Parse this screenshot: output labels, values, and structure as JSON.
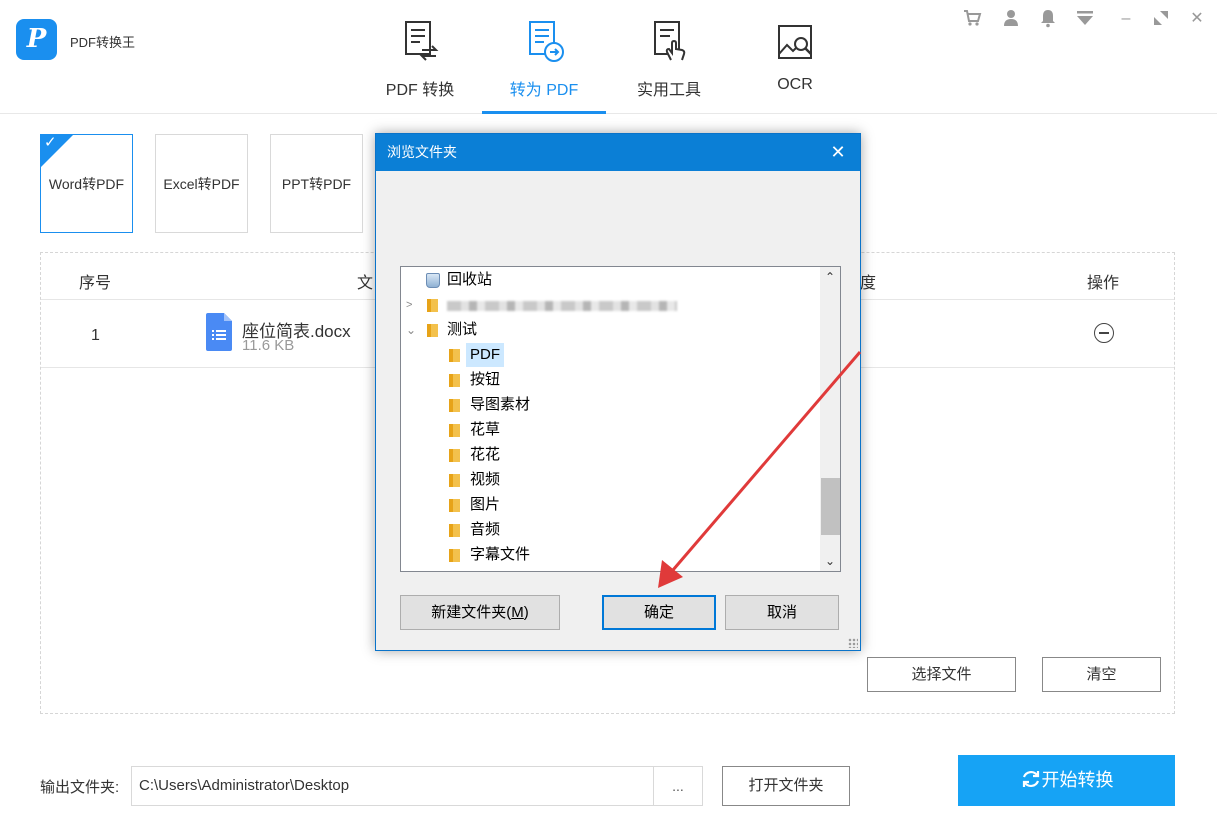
{
  "app": {
    "name": "PDF转换王",
    "logo_letter": "P",
    "brand_color": "#1a8fef"
  },
  "nav": {
    "tabs": [
      {
        "label": "PDF 转换",
        "icon": "pdf-convert-icon",
        "active": false
      },
      {
        "label": "转为 PDF",
        "icon": "to-pdf-icon",
        "active": true
      },
      {
        "label": "实用工具",
        "icon": "tools-icon",
        "active": false
      },
      {
        "label": "OCR",
        "icon": "ocr-icon",
        "active": false
      }
    ]
  },
  "window_controls": [
    "cart-icon",
    "user-icon",
    "bell-icon",
    "menu-icon",
    "minimize-icon",
    "maximize-icon",
    "close-icon"
  ],
  "type_cards": [
    {
      "label": "Word转PDF",
      "active": true
    },
    {
      "label": "Excel转PDF",
      "active": false
    },
    {
      "label": "PPT转PDF",
      "active": false
    }
  ],
  "table": {
    "col_index": "序号",
    "col_file": "文",
    "col_progress": "度",
    "col_action": "操作",
    "rows": [
      {
        "index": "1",
        "name": "座位简表.docx",
        "size": "11.6 KB"
      }
    ]
  },
  "buttons": {
    "choose_file": "选择文件",
    "clear": "清空",
    "open_folder": "打开文件夹",
    "browse": "...",
    "start": "开始转换"
  },
  "output": {
    "label": "输出文件夹:",
    "path": "C:\\Users\\Administrator\\Desktop"
  },
  "dialog": {
    "title": "浏览文件夹",
    "close": "✕",
    "tree": [
      {
        "label": "回收站",
        "type": "recycle"
      },
      {
        "label": "",
        "type": "blurred"
      },
      {
        "label": "测试",
        "type": "folder-expanded"
      },
      {
        "label": "PDF",
        "type": "folder",
        "selected": true
      },
      {
        "label": "按钮",
        "type": "folder"
      },
      {
        "label": "导图素材",
        "type": "folder"
      },
      {
        "label": "花草",
        "type": "folder"
      },
      {
        "label": "花花",
        "type": "folder"
      },
      {
        "label": "视频",
        "type": "folder"
      },
      {
        "label": "图片",
        "type": "folder"
      },
      {
        "label": "音频",
        "type": "folder"
      },
      {
        "label": "字幕文件",
        "type": "folder"
      }
    ],
    "new_folder_label": "新建文件夹(",
    "new_folder_key": "M",
    "new_folder_suffix": ")",
    "ok_label": "确定",
    "cancel_label": "取消"
  },
  "annotation_color": "#e03a3a"
}
